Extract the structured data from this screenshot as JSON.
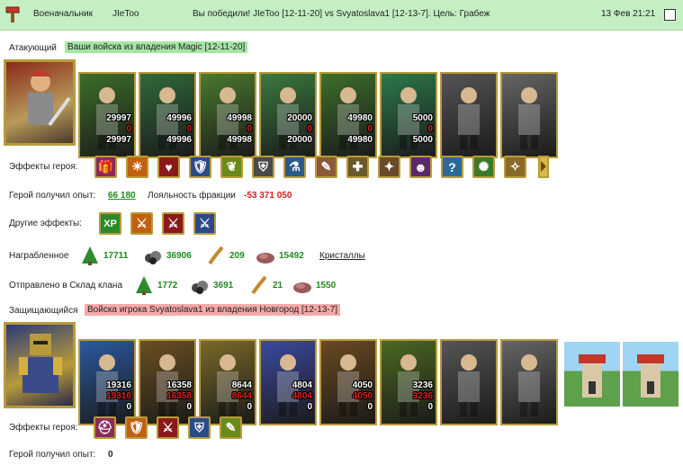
{
  "header": {
    "role_label": "Военачальник",
    "player": "JIeToo",
    "battle_text": "Вы победили! JIeToo [12-11-20] vs Svyatoslava1 [12-13-7]. Цель: Грабеж",
    "date": "13 Фев 21:21"
  },
  "attacker": {
    "label": "Атакующий",
    "tag": "Ваши войска из владения Magic [12-11-20]",
    "units": [
      {
        "n1": "29997",
        "n2": "0",
        "n3": "29997",
        "color": "#3d6e2a"
      },
      {
        "n1": "49996",
        "n2": "0",
        "n3": "49996",
        "color": "#2f6a3a"
      },
      {
        "n1": "49998",
        "n2": "0",
        "n3": "49998",
        "color": "#4a7a2e"
      },
      {
        "n1": "20000",
        "n2": "0",
        "n3": "20000",
        "color": "#3a7a40"
      },
      {
        "n1": "49980",
        "n2": "0",
        "n3": "49980",
        "color": "#3c6f2c"
      },
      {
        "n1": "5000",
        "n2": "0",
        "n3": "5000",
        "color": "#2c7a4a"
      },
      {
        "n1": "",
        "n2": "",
        "n3": "",
        "color": "#555555"
      },
      {
        "n1": "",
        "n2": "",
        "n3": "",
        "color": "#666666"
      }
    ],
    "effects_label": "Эффекты героя:",
    "effects": [
      "gift-icon",
      "sun-icon",
      "heart-icon",
      "shield-icon",
      "fruit-icon",
      "armor-icon",
      "potion-icon",
      "scroll-icon",
      "cross-icon",
      "bird-icon",
      "mask-icon",
      "question-icon",
      "dragon-icon",
      "rune-icon"
    ],
    "exp_label": "Герой получил опыт:",
    "exp_value": "66 180",
    "loyalty_label": "Лояльность фракции",
    "loyalty_value": "-53 371 050",
    "other_label": "Другие эффекты:",
    "other_effects": [
      "XP",
      "sword-icon",
      "sword-icon",
      "sword-icon"
    ],
    "loot_label": "Награбленное",
    "loot": [
      {
        "icon": "tree-icon",
        "value": "17711"
      },
      {
        "icon": "ore-icon",
        "value": "36906"
      },
      {
        "icon": "grain-icon",
        "value": "209"
      },
      {
        "icon": "stone-icon",
        "value": "15492"
      }
    ],
    "crystals_link": "Кристаллы",
    "sent_label": "Отправлено в Склад клана",
    "sent": [
      {
        "icon": "tree-icon",
        "value": "1772"
      },
      {
        "icon": "ore-icon",
        "value": "3691"
      },
      {
        "icon": "grain-icon",
        "value": "21"
      },
      {
        "icon": "stone-icon",
        "value": "1550"
      }
    ]
  },
  "defender": {
    "label": "Защищающийся",
    "tag": "Войска игрока Svyatoslava1 из владения Новгород [12-13-7]",
    "units": [
      {
        "n1": "19316",
        "n2": "19316",
        "n3": "0",
        "color": "#2a5aa0"
      },
      {
        "n1": "16358",
        "n2": "16358",
        "n3": "0",
        "color": "#6a5020"
      },
      {
        "n1": "8644",
        "n2": "8644",
        "n3": "0",
        "color": "#7a6a28"
      },
      {
        "n1": "4804",
        "n2": "4804",
        "n3": "0",
        "color": "#3a4aa0"
      },
      {
        "n1": "4050",
        "n2": "4050",
        "n3": "0",
        "color": "#6a4a20"
      },
      {
        "n1": "3236",
        "n2": "3236",
        "n3": "0",
        "color": "#4a6a20"
      },
      {
        "n1": "",
        "n2": "",
        "n3": "",
        "color": "#555555"
      },
      {
        "n1": "",
        "n2": "",
        "n3": "",
        "color": "#666666"
      }
    ],
    "effects_label": "Эффекты героя:",
    "effects": [
      "helmet-icon",
      "shield-icon",
      "sword-icon",
      "armor-icon",
      "scroll-icon"
    ],
    "exp_label": "Герой получил опыт:",
    "exp_value": "0"
  }
}
